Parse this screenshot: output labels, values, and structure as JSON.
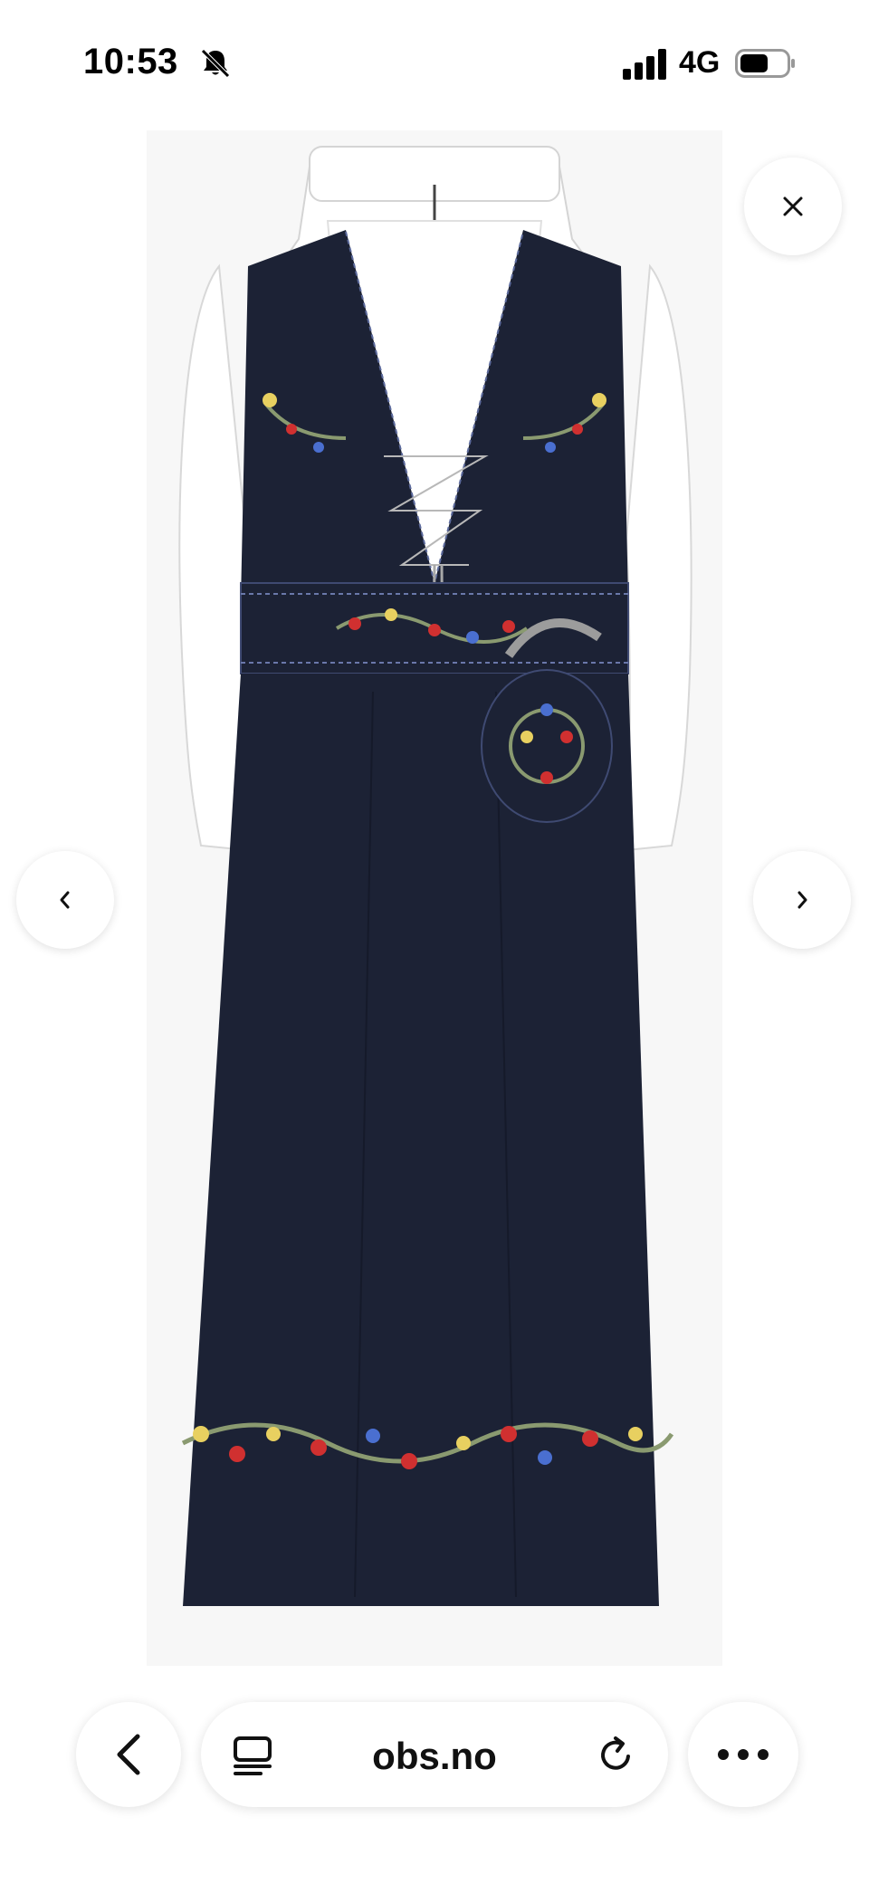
{
  "status_bar": {
    "time": "10:53",
    "network": "4G",
    "icons": [
      "bell-slash-icon",
      "signal-bars-icon",
      "battery-icon"
    ]
  },
  "viewer": {
    "image_subject": "bunad-product-photo",
    "close_icon": "close-icon",
    "prev_icon": "chevron-left-icon",
    "next_icon": "chevron-right-icon"
  },
  "browser": {
    "url": "obs.no",
    "icons": [
      "back-arrow-icon",
      "reader-mode-icon",
      "reload-icon",
      "more-icon"
    ]
  },
  "colors": {
    "garment": "#1c2235",
    "shirt": "#ffffff",
    "photo_bg": "#f7f7f7",
    "button_bg": "#ffffff"
  }
}
